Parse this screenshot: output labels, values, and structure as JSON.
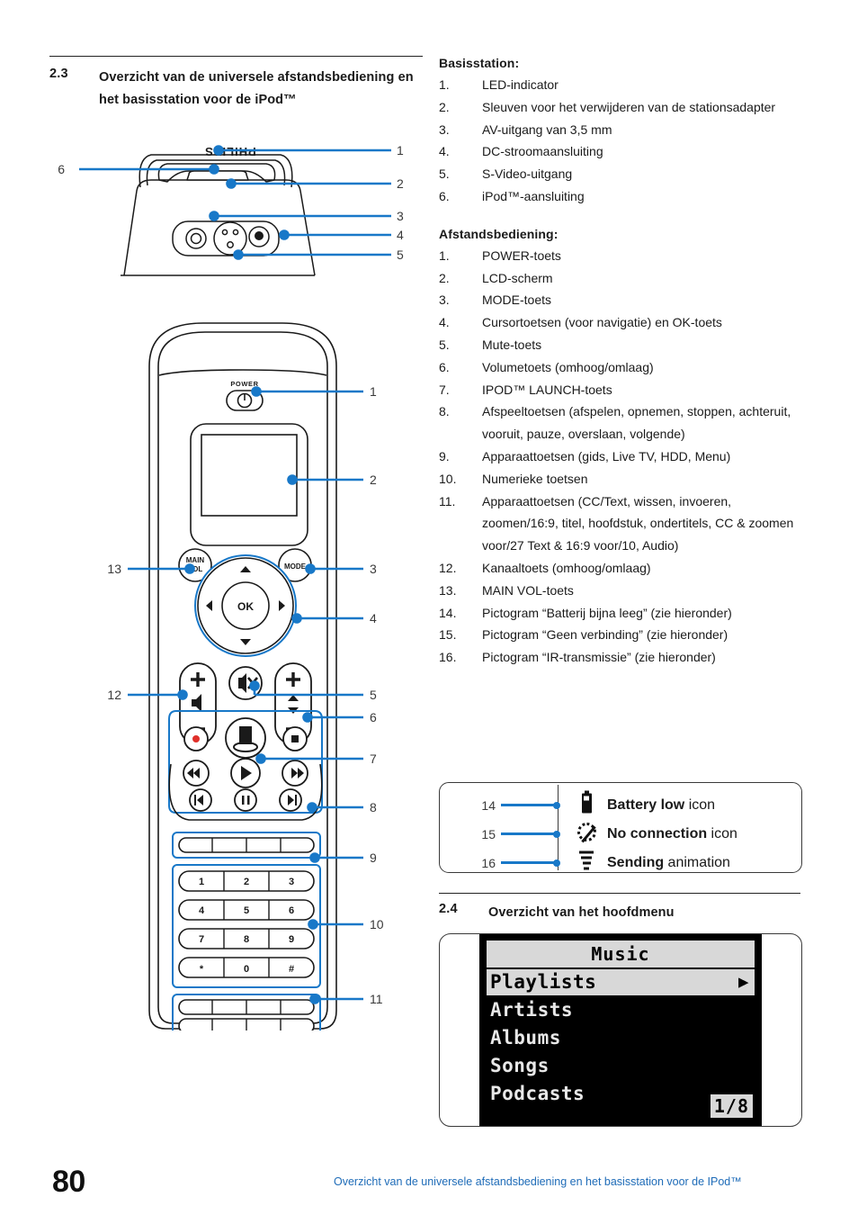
{
  "colors": {
    "callout_blue": "#1878c8",
    "footer_blue": "#1f6cb8",
    "ink": "#1a1a1a"
  },
  "section_23": {
    "number": "2.3",
    "title": "Overzicht van de universele afstandsbediening en het basisstation voor de iPod™"
  },
  "section_24": {
    "number": "2.4",
    "title": "Overzicht van het hoofdmenu"
  },
  "basestation": {
    "heading": "Basisstation:",
    "items": [
      {
        "n": "1.",
        "t": "LED-indicator"
      },
      {
        "n": "2.",
        "t": "Sleuven voor het verwijderen van de stationsadapter"
      },
      {
        "n": "3.",
        "t": "AV-uitgang van 3,5 mm"
      },
      {
        "n": "4.",
        "t": "DC-stroomaansluiting"
      },
      {
        "n": "5.",
        "t": "S-Video-uitgang"
      },
      {
        "n": "6.",
        "t": "iPod™-aansluiting"
      }
    ],
    "callouts": [
      "1",
      "2",
      "3",
      "4",
      "5",
      "6"
    ],
    "brand": "PHILIPS"
  },
  "remote": {
    "heading": "Afstandsbediening:",
    "items": [
      {
        "n": "1.",
        "t": "POWER-toets"
      },
      {
        "n": "2.",
        "t": "LCD-scherm"
      },
      {
        "n": "3.",
        "t": "MODE-toets"
      },
      {
        "n": "4.",
        "t": "Cursortoetsen (voor navigatie) en OK-toets"
      },
      {
        "n": "5.",
        "t": "Mute-toets"
      },
      {
        "n": "6.",
        "t": "Volumetoets (omhoog/omlaag)"
      },
      {
        "n": "7.",
        "t": "IPOD™ LAUNCH-toets"
      },
      {
        "n": "8.",
        "t": "Afspeeltoetsen (afspelen, opnemen, stoppen, achteruit, vooruit, pauze, overslaan, volgende)"
      },
      {
        "n": "9.",
        "t": "Apparaattoetsen (gids, Live TV, HDD, Menu)"
      },
      {
        "n": "10.",
        "t": "Numerieke toetsen"
      },
      {
        "n": "11.",
        "t": "Apparaattoetsen (CC/Text, wissen, invoeren, zoomen/16:9, titel, hoofdstuk, ondertitels, CC & zoomen voor/27 Text & 16:9 voor/10, Audio)"
      },
      {
        "n": "12.",
        "t": "Kanaaltoets (omhoog/omlaag)"
      },
      {
        "n": "13.",
        "t": "MAIN VOL-toets"
      },
      {
        "n": "14.",
        "t": "Pictogram “Batterij bijna leeg” (zie hieronder)"
      },
      {
        "n": "15.",
        "t": "Pictogram “Geen verbinding” (zie hieronder)"
      },
      {
        "n": "16.",
        "t": "Pictogram “IR-transmissie” (zie hieronder)"
      }
    ],
    "button_labels": {
      "power": "POWER",
      "main_vol": "MAIN VOL",
      "mode": "MODE",
      "ok": "OK"
    },
    "keypad": [
      [
        "1",
        "2",
        "3"
      ],
      [
        "4",
        "5",
        "6"
      ],
      [
        "7",
        "8",
        "9"
      ],
      [
        "*",
        "0",
        "#"
      ]
    ],
    "callouts_right": [
      "1",
      "2",
      "3",
      "4",
      "5",
      "6",
      "7",
      "8",
      "9",
      "10",
      "11"
    ],
    "callouts_left": [
      "13",
      "12"
    ]
  },
  "legend": {
    "rows": [
      {
        "num": "14",
        "icon": "battery-low-icon",
        "bold": "Battery low",
        "rest": " icon"
      },
      {
        "num": "15",
        "icon": "no-connection-icon",
        "bold": "No connection",
        "rest": " icon"
      },
      {
        "num": "16",
        "icon": "sending-animation-icon",
        "bold": "Sending",
        "rest": " animation"
      }
    ]
  },
  "lcd": {
    "title": "Music",
    "items": [
      "Playlists",
      "Artists",
      "Albums",
      "Songs",
      "Podcasts"
    ],
    "selected_index": 0,
    "arrow": "▶",
    "counter": "1/8"
  },
  "footer": {
    "page_number": "80",
    "text": "Overzicht van de universele afstandsbediening en het basisstation voor de IPod™"
  }
}
